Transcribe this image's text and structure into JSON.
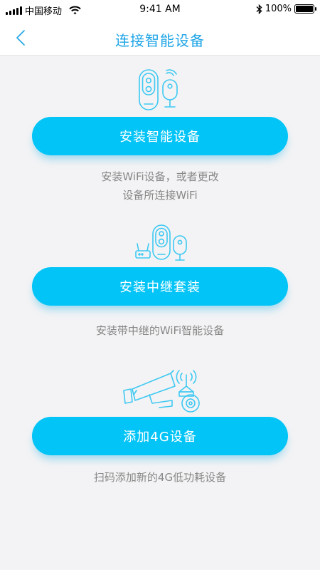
{
  "status_bar": {
    "carrier": "中国移动",
    "time": "9:41 AM",
    "battery": "100%",
    "battery_level": 1.0
  },
  "header": {
    "title": "连接智能设备"
  },
  "options": [
    {
      "button_label": "安装智能设备",
      "description_lines": [
        "安装WiFi设备，或者更改",
        "设备所连接WiFi"
      ]
    },
    {
      "button_label": "安装中继套装",
      "description_lines": [
        "安装带中继的WiFi智能设备"
      ]
    },
    {
      "button_label": "添加4G设备",
      "description_lines": [
        "扫码添加新的4G低功耗设备"
      ]
    }
  ],
  "colors": {
    "accent": "#02c4f7",
    "title": "#1fa5e6",
    "icon_line": "#3ec9f2",
    "background": "#f3f3f5",
    "description": "#888888"
  },
  "icons": [
    "back-chevron-icon",
    "doorbell-camera-icon",
    "repeater-kit-icon",
    "4g-camera-icon"
  ]
}
